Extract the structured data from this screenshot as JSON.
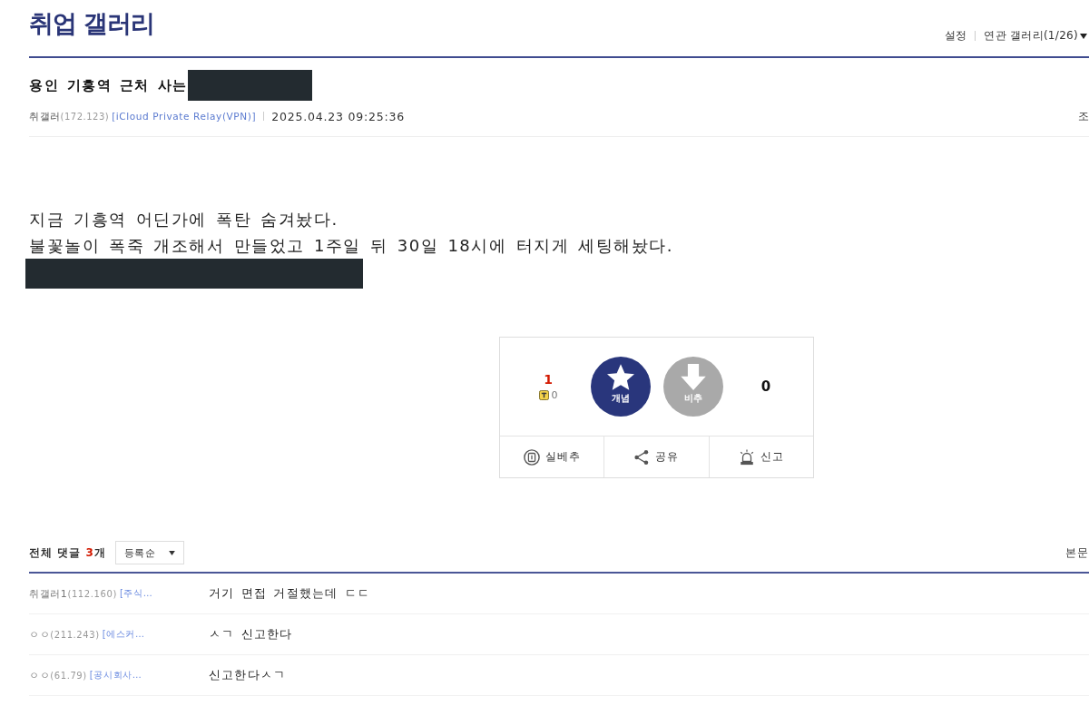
{
  "gallery": {
    "title": "취업 갤러리",
    "links": [
      {
        "label": "설정",
        "dropdown": false
      },
      {
        "label": "연관 갤러리(1/26)",
        "dropdown": true
      }
    ]
  },
  "post": {
    "title": "용인 기흥역 근처 사는",
    "title_redacted": true,
    "author": {
      "nick": "취갤러",
      "ip": "(172.123)",
      "tag": "[iCloud Private Relay(VPN)]"
    },
    "date": "2025.04.23 09:25:36",
    "meta_right": "조",
    "body": [
      {
        "kind": "text",
        "text": "지금 기흥역 어딘가에 폭탄 숨겨놨다."
      },
      {
        "kind": "text",
        "text": "불꽃놀이 폭죽 개조해서 만들었고 1주일 뒤 30일 18시에 터지게 세팅해놨다."
      },
      {
        "kind": "redacted"
      }
    ]
  },
  "recommend": {
    "up_count": "1",
    "fixed_nick_count": "0",
    "up_label": "개념",
    "down_label": "비추",
    "down_count": "0",
    "actions": [
      {
        "kind": "best",
        "label": "실베추"
      },
      {
        "kind": "share",
        "label": "공유"
      },
      {
        "kind": "report",
        "label": "신고"
      }
    ]
  },
  "comments": {
    "label": "전체 댓글",
    "count": "3",
    "unit": "개",
    "sort": "등록순",
    "side_link": "본문",
    "rows": [
      {
        "nick": "취갤러1",
        "ip": "(112.160)",
        "tag": "[주식…",
        "text": "거기 면접 거절했는데 ㄷㄷ"
      },
      {
        "nick": "ㅇㅇ",
        "ip": "(211.243)",
        "tag": "[에스커…",
        "text": "ㅅㄱ 신고한다"
      },
      {
        "nick": "ㅇㅇ",
        "ip": "(61.79)",
        "tag": "[공시회사…",
        "text": "신고한다ㅅㄱ"
      }
    ]
  }
}
